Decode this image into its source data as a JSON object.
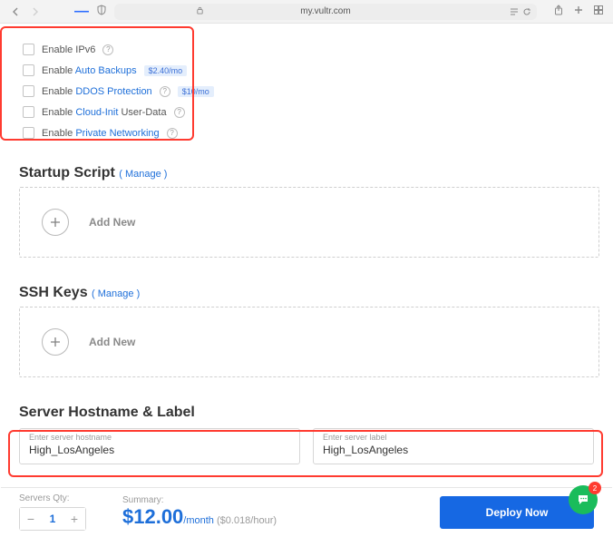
{
  "browser": {
    "url": "my.vultr.com"
  },
  "options": {
    "ipv6": {
      "prefix": "Enable IPv6"
    },
    "backups": {
      "prefix": "Enable ",
      "link": "Auto Backups",
      "badge": "$2.40/mo"
    },
    "ddos": {
      "prefix": "Enable ",
      "link": "DDOS Protection",
      "badge": "$10/mo"
    },
    "cloudinit": {
      "prefix": "Enable ",
      "link": "Cloud-Init",
      "suffix": " User-Data"
    },
    "privnet": {
      "prefix": "Enable ",
      "link": "Private Networking"
    }
  },
  "sections": {
    "startup": {
      "title": "Startup Script",
      "manage": "( Manage )",
      "add": "Add New"
    },
    "ssh": {
      "title": "SSH Keys",
      "manage": "( Manage )",
      "add": "Add New"
    },
    "hostname": {
      "title": "Server Hostname & Label"
    }
  },
  "fields": {
    "hostname": {
      "label": "Enter server hostname",
      "value": "High_LosAngeles"
    },
    "serverlabel": {
      "label": "Enter server label",
      "value": "High_LosAngeles"
    }
  },
  "footer": {
    "qty_label": "Servers Qty:",
    "qty": "1",
    "summary_label": "Summary:",
    "price_main": "$12.00",
    "price_per": "/month",
    "price_hour": " ($0.018/hour)",
    "deploy": "Deploy Now"
  },
  "chat": {
    "count": "2"
  }
}
